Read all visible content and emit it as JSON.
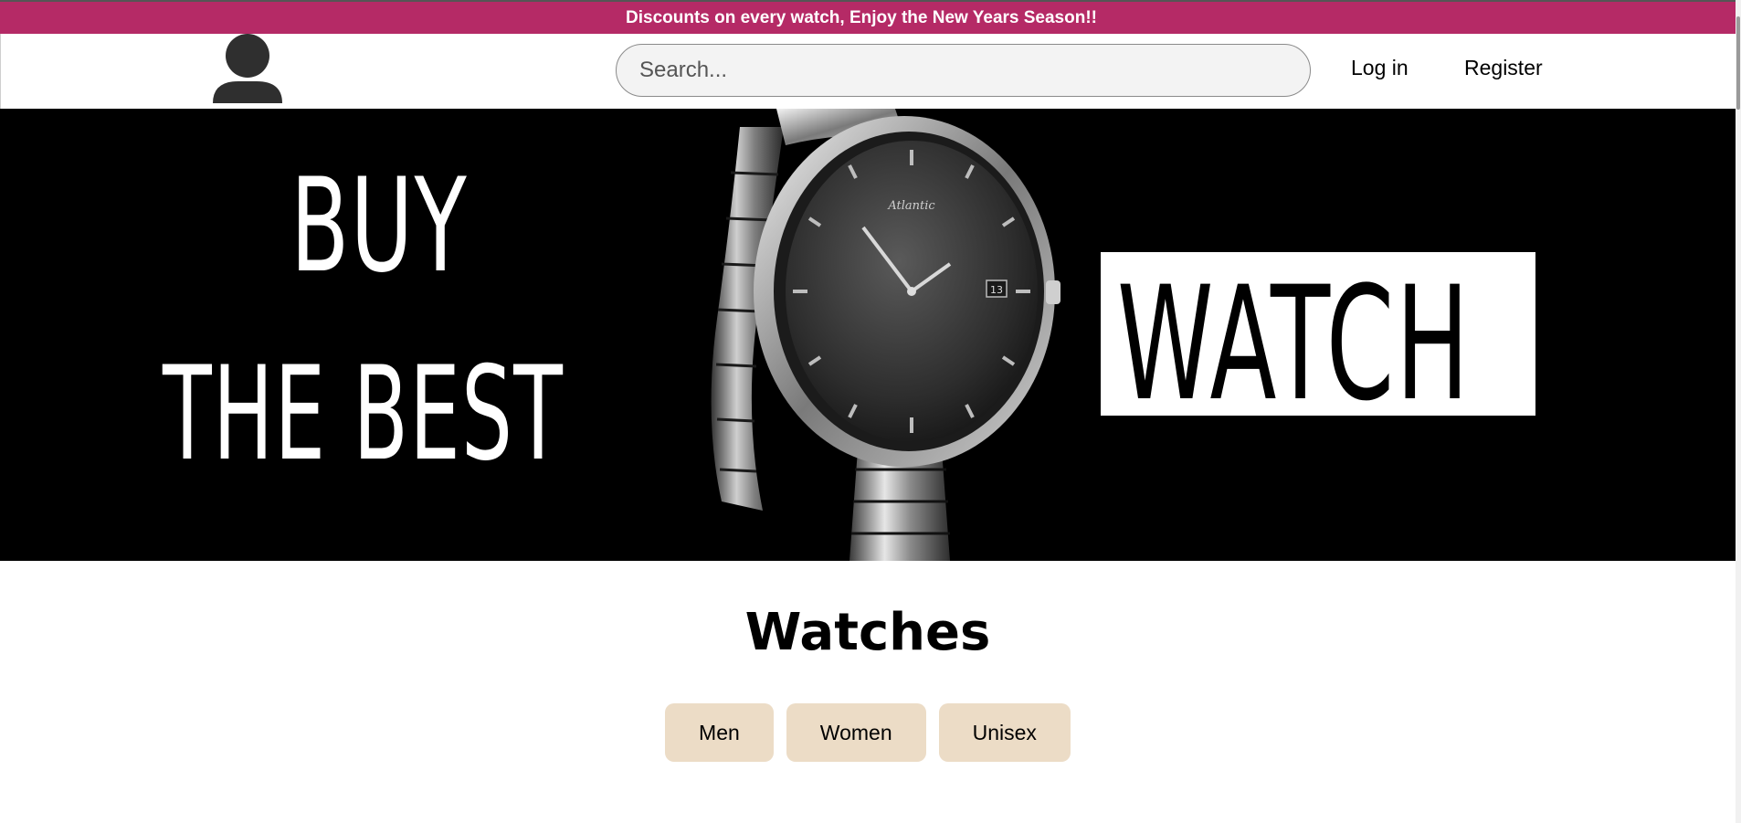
{
  "promo": {
    "text": "Discounts on every watch, Enjoy the New Years Season!!"
  },
  "header": {
    "search_placeholder": "Search...",
    "login_label": "Log in",
    "register_label": "Register"
  },
  "hero": {
    "line1": "BUY",
    "line2": "THE BEST",
    "highlight": "WATCH",
    "dial_brand": "Atlantic",
    "dial_date": "13"
  },
  "section": {
    "title": "Watches",
    "categories": [
      {
        "label": "Men"
      },
      {
        "label": "Women"
      },
      {
        "label": "Unisex"
      }
    ]
  },
  "colors": {
    "promo_bg": "#b52a66",
    "category_bg": "#ecdcc6",
    "hero_bg": "#000000"
  }
}
